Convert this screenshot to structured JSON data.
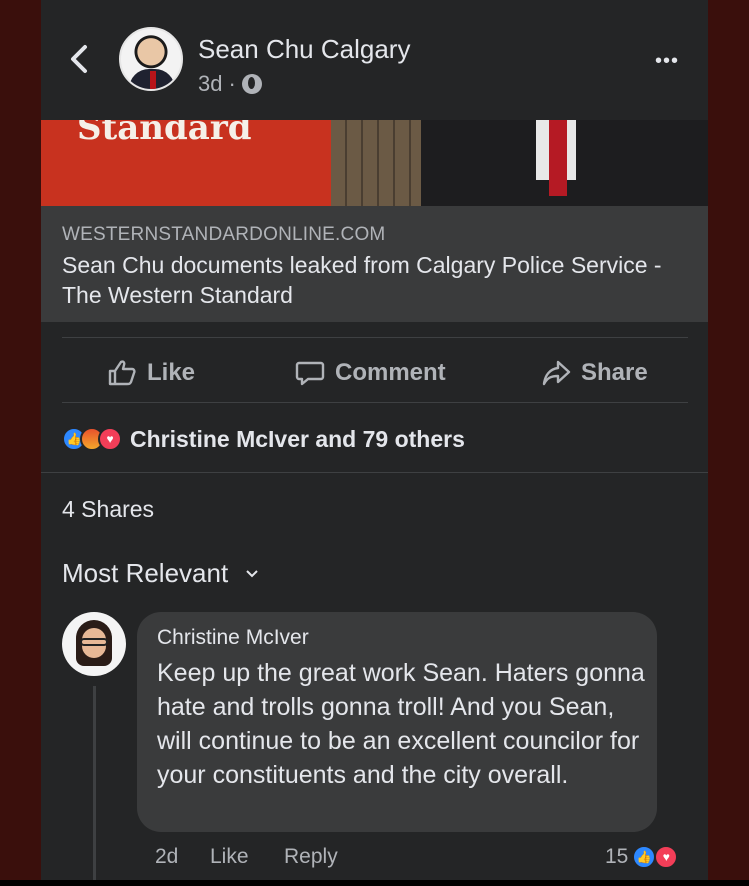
{
  "header": {
    "back_label": "Back",
    "poster_name": "Sean Chu Calgary",
    "time": "3d",
    "separator": "·",
    "privacy_icon": "globe-icon",
    "more_label": "•••"
  },
  "link": {
    "image_brand_text": "Standard",
    "domain": "WESTERNSTANDARDONLINE.COM",
    "headline": "Sean Chu documents leaked from Calgary Police Service - The Western Standard"
  },
  "actions": {
    "like": "Like",
    "comment": "Comment",
    "share": "Share"
  },
  "reactions": {
    "types": [
      "like",
      "angry",
      "love"
    ],
    "summary": "Christine McIver and 79 others"
  },
  "shares": "4 Shares",
  "sort_label": "Most Relevant",
  "comment": {
    "author": "Christine McIver",
    "text": "Keep up the great work Sean. Haters gonna hate and trolls gonna troll! And you Sean, will continue to be an excellent councilor for your constituents and the city overall.",
    "time": "2d",
    "like": "Like",
    "reply": "Reply",
    "reaction_count": "15"
  },
  "colors": {
    "background": "#242526",
    "surface": "#3a3b3c",
    "text_primary": "#e4e6eb",
    "text_secondary": "#b0b3b8",
    "like_blue": "#2d88ff",
    "love_red": "#f33e58"
  }
}
